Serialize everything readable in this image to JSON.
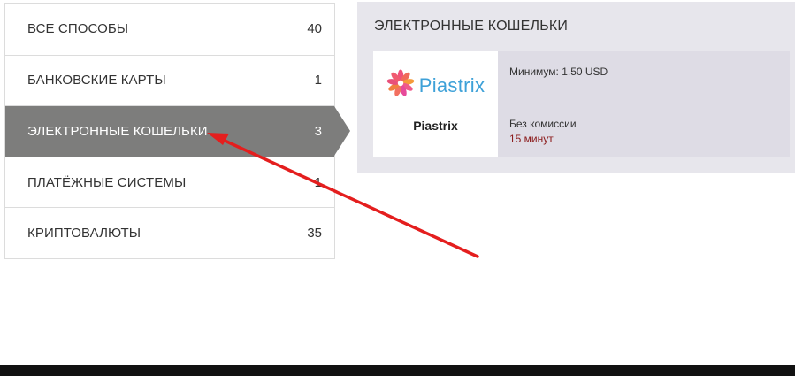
{
  "categories": [
    {
      "label": "ВСЕ СПОСОБЫ",
      "count": "40"
    },
    {
      "label": "БАНКОВСКИЕ КАРТЫ",
      "count": "1"
    },
    {
      "label": "ЭЛЕКТРОННЫЕ КОШЕЛЬКИ",
      "count": "3"
    },
    {
      "label": "ПЛАТЁЖНЫЕ СИСТЕМЫ",
      "count": "1"
    },
    {
      "label": "КРИПТОВАЛЮТЫ",
      "count": "35"
    }
  ],
  "active_category_index": 2,
  "panel": {
    "title": "ЭЛЕКТРОННЫЕ КОШЕЛЬКИ",
    "method": {
      "logo_icon": "piastrix-flower-icon",
      "logo_text": "Piastrix",
      "name": "Piastrix",
      "minimum": "Минимум: 1.50 USD",
      "fee": "Без комиссии",
      "time": "15 минут"
    }
  },
  "colors": {
    "active_item_bg": "#7d7d7c",
    "panel_bg": "#e7e6ec",
    "card_info_bg": "#dedce5",
    "time_text": "#8b1a1a",
    "annotation_arrow": "#e41e1e",
    "logo_blue": "#3ea1d8",
    "footer": "#111111"
  }
}
